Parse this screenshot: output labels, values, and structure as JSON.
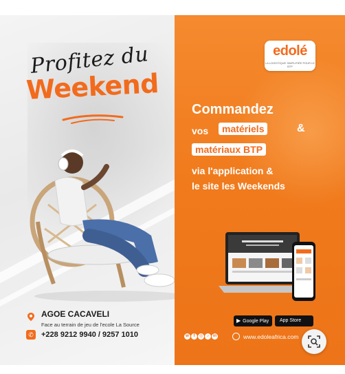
{
  "left": {
    "script_title": "Profitez du",
    "weekend": "Weekend",
    "location_name": "AGOE CACAVELI",
    "location_desc": "Face au terrain de jeu de l'ecole La Source",
    "phone": "+228 9212 9940 / 9257 1010"
  },
  "right": {
    "logo": "edolé",
    "logo_tagline": "LA LOGISTIQUE SIMPLIFIÉE POUR LE BTP",
    "headline": "Commandez",
    "vos": "vos",
    "pill1": "matériels",
    "amp": "&",
    "pill2": "matériaux BTP",
    "line4": "via l'application &",
    "line5": "le site les Weekends",
    "google_play_small": "GET IT ON",
    "google_play": "Google Play",
    "app_store_small": "Download on the",
    "app_store": "App Store",
    "website": "www.edoleafrica.com"
  },
  "colors": {
    "brand_orange": "#f26b1d",
    "panel_orange": "#f07a1c"
  },
  "icons": [
    "location-pin-icon",
    "phone-icon",
    "google-play-icon",
    "apple-icon",
    "globe-icon",
    "social-icons",
    "zoom-lens-icon"
  ]
}
